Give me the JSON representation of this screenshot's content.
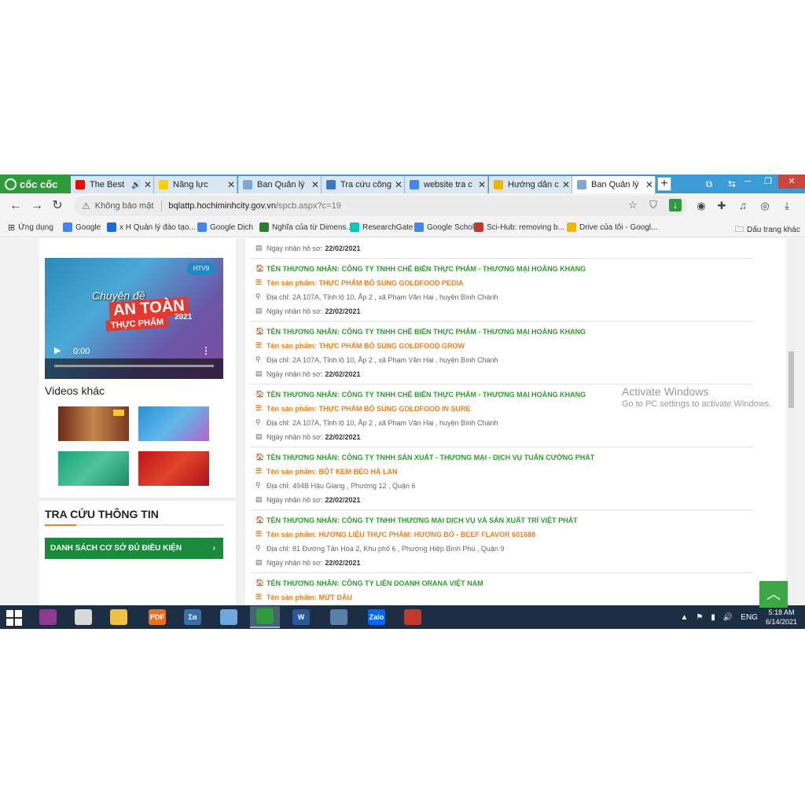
{
  "browser": {
    "brand": "cốc cốc",
    "tabs": [
      {
        "label": "The Best",
        "icon": "youtube-icon",
        "color": "#ff0000",
        "audio": "🔊",
        "active": false
      },
      {
        "label": "Năng lực",
        "icon": "page-icon",
        "color": "#ffd000",
        "active": false
      },
      {
        "label": "Ban Quản lý",
        "icon": "document-icon",
        "color": "#7fa7d6",
        "active": false
      },
      {
        "label": "Tra cứu công",
        "icon": "document-icon",
        "color": "#3a77c4",
        "active": false
      },
      {
        "label": "website tra c",
        "icon": "google-icon",
        "color": "#4285f4",
        "active": false
      },
      {
        "label": "Hướng dẫn c",
        "icon": "page-icon",
        "color": "#f0b400",
        "active": false
      },
      {
        "label": "Ban Quản lý",
        "icon": "document-icon",
        "color": "#7fa7d6",
        "active": true
      }
    ],
    "new_tab": "+",
    "security_label": "Không bảo mật",
    "url_host": "bqlattp.hochiminhcity.gov.vn",
    "url_path": "/spcb.aspx?c=19"
  },
  "bookmarks": {
    "apps": "Ứng dụng",
    "items": [
      {
        "label": "Google",
        "color": "#4285f4"
      },
      {
        "label": "x H Quản lý đào tạo...",
        "color": "#1a6ad8"
      },
      {
        "label": "Google Dịch",
        "color": "#4285f4"
      },
      {
        "label": "Nghĩa của từ Dimens...",
        "color": "#2e7d32"
      },
      {
        "label": "ResearchGate",
        "color": "#00ccbb"
      },
      {
        "label": "Google Scholar",
        "color": "#4285f4"
      },
      {
        "label": "Sci-Hub: removing b...",
        "color": "#c0392b"
      },
      {
        "label": "Drive của tôi - Googl...",
        "color": "#f4b400"
      }
    ],
    "other": "Dấu trang khác"
  },
  "sidebar": {
    "video": {
      "channel": "HTV9",
      "title_line1": "Chuyên đề",
      "title_line2": "AN TOÀN",
      "title_line3": "THỰC PHẨM",
      "year": "2021",
      "time": "0:00",
      "progress": 0
    },
    "videos_heading": "Videos khác",
    "search_heading": "TRA CỨU THÔNG TIN",
    "qualified_button": "DANH SÁCH CƠ SỞ ĐỦ ĐIỀU KIỆN",
    "qualified_arrow": "›"
  },
  "records": {
    "merchant_prefix": "TÊN THƯƠNG NHÂN:",
    "product_prefix": "Tên sản phẩm:",
    "address_prefix": "Địa chỉ:",
    "date_prefix": "Ngày nhận hồ sơ:",
    "items": [
      {
        "merchant": "",
        "product": "",
        "address": "",
        "date": "22/02/2021"
      },
      {
        "merchant": "CÔNG TY TNHH CHẾ BIẾN THỰC PHẨM - THƯƠNG MẠI HOÀNG KHANG",
        "product": "THỰC PHẨM BỔ SUNG GOLDFOOD PEDIA",
        "address": "2A 107A, Tỉnh lộ 10, Ấp 2 , xã Phạm Văn Hai , huyện Bình Chánh",
        "date": "22/02/2021"
      },
      {
        "merchant": "CÔNG TY TNHH CHẾ BIẾN THỰC PHẨM - THƯƠNG MẠI HOÀNG KHANG",
        "product": "THỰC PHẨM BỔ SUNG GOLDFOOD GROW",
        "address": "2A 107A, Tỉnh lộ 10, Ấp 2 , xã Phạm Văn Hai , huyện Bình Chánh",
        "date": "22/02/2021"
      },
      {
        "merchant": "CÔNG TY TNHH CHẾ BIẾN THỰC PHẨM - THƯƠNG MẠI HOÀNG KHANG",
        "product": "THỰC PHẨM BỔ SUNG GOLDFOOD IN SURE",
        "address": "2A 107A, Tỉnh lộ 10, Ấp 2 , xã Phạm Văn Hai , huyện Bình Chánh",
        "date": "22/02/2021"
      },
      {
        "merchant": "CÔNG TY TNHH SẢN XUẤT - THƯƠNG MẠI - DỊCH VỤ TUẤN CƯỜNG PHÁT",
        "product": "BỘT KEM BÉO HÀ LAN",
        "address": "494B Hậu Giang , Phường 12 , Quận 6",
        "date": "22/02/2021"
      },
      {
        "merchant": "CÔNG TY TNHH THƯƠNG MẠI DỊCH VỤ VÀ SẢN XUẤT TRÍ VIỆT PHÁT",
        "product": "HƯƠNG LIỆU THỰC PHẨM: HƯƠNG BÒ - BEEF FLAVOR 601688",
        "address": "81 Đường Tân Hòa 2, Khu phố 6 , Phường Hiệp Bình Phú , Quận 9",
        "date": "22/02/2021"
      },
      {
        "merchant": "CÔNG TY LIÊN DOANH ORANA VIỆT NAM",
        "product": "MỨT DÂU",
        "address": "",
        "date": ""
      }
    ]
  },
  "watermark": {
    "line1": "Activate Windows",
    "line2": "Go to PC settings to activate Windows."
  },
  "taskbar": {
    "apps": [
      {
        "name": "winrar-icon",
        "label": "",
        "color": "#8e3a8e"
      },
      {
        "name": "app-grid-icon",
        "label": "",
        "color": "#d8d8d8"
      },
      {
        "name": "file-explorer-icon",
        "label": "",
        "color": "#f0c040"
      },
      {
        "name": "foxit-pdf-icon",
        "label": "PDF",
        "color": "#e8711a"
      },
      {
        "name": "mathtype-icon",
        "label": "Σα",
        "color": "#3a6ea8"
      },
      {
        "name": "paint-icon",
        "label": "",
        "color": "#6fa8dc"
      },
      {
        "name": "coccoc-icon",
        "label": "",
        "color": "#2e9c3d"
      },
      {
        "name": "word-icon",
        "label": "W",
        "color": "#2b579a"
      },
      {
        "name": "remote-desktop-icon",
        "label": "",
        "color": "#5a7fa8"
      },
      {
        "name": "zalo-icon",
        "label": "Zalo",
        "color": "#0068ff"
      },
      {
        "name": "unikey-icon",
        "label": "",
        "color": "#c0392b"
      }
    ],
    "language": "ENG",
    "time": "5:18 AM",
    "date": "6/14/2021"
  }
}
